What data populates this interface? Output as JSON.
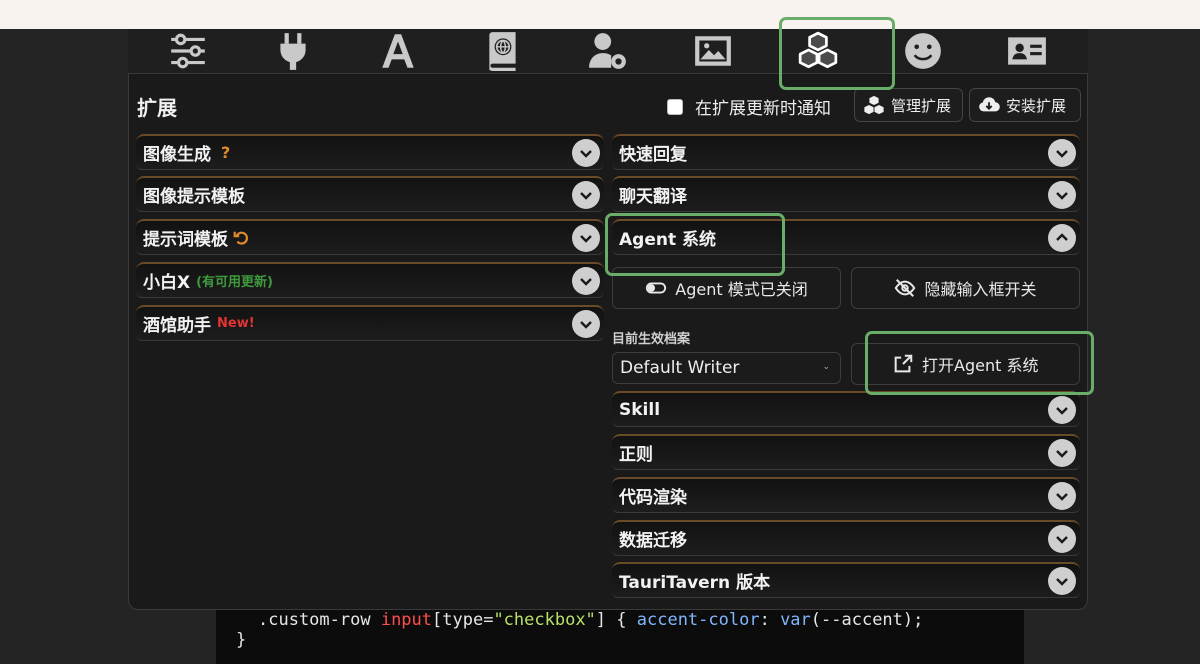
{
  "toolbar": {
    "icons": [
      {
        "name": "sliders-icon"
      },
      {
        "name": "plug-icon"
      },
      {
        "name": "font-icon"
      },
      {
        "name": "book-globe-icon"
      },
      {
        "name": "user-gear-icon"
      },
      {
        "name": "image-icon"
      },
      {
        "name": "cubes-icon",
        "active": true
      },
      {
        "name": "smiley-icon"
      },
      {
        "name": "id-card-icon"
      }
    ]
  },
  "header": {
    "title": "扩展",
    "notify_label": "在扩展更新时通知",
    "manage_label": "管理扩展",
    "install_label": "安装扩展"
  },
  "left": {
    "items": [
      {
        "label": "图像生成",
        "badge": "?"
      },
      {
        "label": "图像提示模板"
      },
      {
        "label": "提示词模板"
      },
      {
        "label": "小白X",
        "badge": "(有可用更新)"
      },
      {
        "label": "酒馆助手",
        "badge": "New!"
      }
    ]
  },
  "right": {
    "items": [
      {
        "label": "快速回复"
      },
      {
        "label": "聊天翻译"
      },
      {
        "label": "Agent 系统",
        "expanded": true
      },
      {
        "label": "Skill"
      },
      {
        "label": "正则"
      },
      {
        "label": "代码渲染"
      },
      {
        "label": "数据迁移"
      },
      {
        "label": "TauriTavern 版本"
      }
    ],
    "agent": {
      "mode_label": "Agent 模式已关闭",
      "hide_input_label": "隐藏输入框开关",
      "profile_label": "目前生效档案",
      "profile_value": "Default Writer",
      "open_label": "打开Agent 系统"
    }
  },
  "code": {
    "line1": {
      "a": ".custom-row ",
      "b": "input",
      "c": "[type=",
      "d": "\"checkbox\"",
      "e": "] { ",
      "f": "accent-color",
      "g": ": ",
      "h": "var",
      "i": "(--accent);"
    },
    "line2": "}"
  },
  "colors": {
    "highlight": "#6aad6a",
    "accent_orange": "#e08a2a",
    "update_green": "#3d9a3d",
    "new_red": "#e23434"
  }
}
